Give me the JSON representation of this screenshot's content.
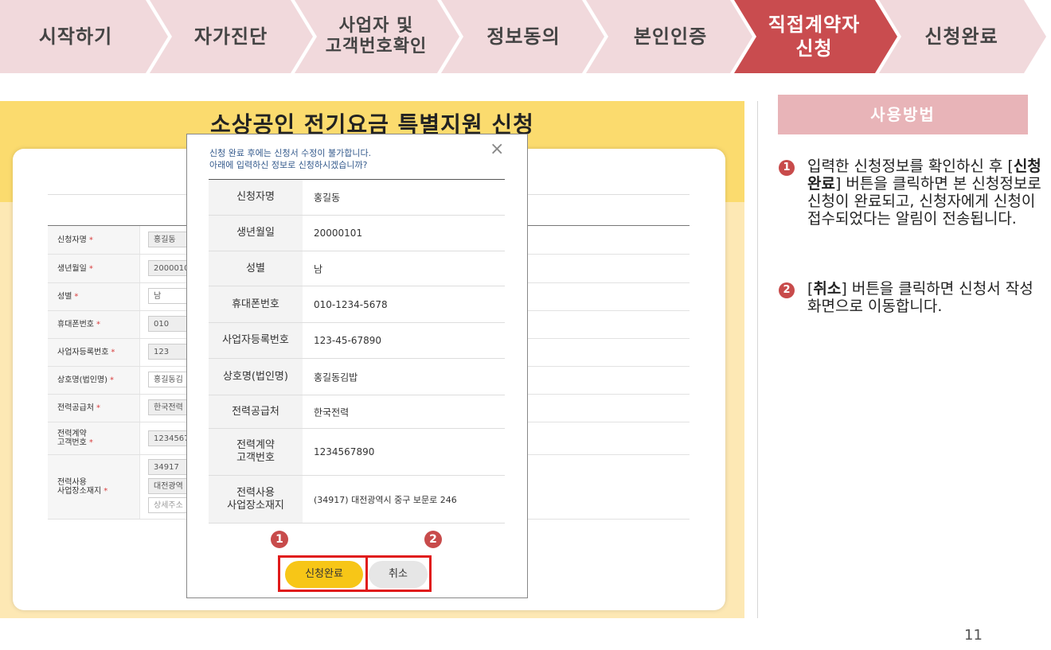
{
  "steps": [
    {
      "label": "시작하기",
      "active": false
    },
    {
      "label": "자가진단",
      "active": false
    },
    {
      "label": "사업자 및\n고객번호확인",
      "active": false
    },
    {
      "label": "정보동의",
      "active": false
    },
    {
      "label": "본인인증",
      "active": false
    },
    {
      "label": "직접계약자\n신청",
      "active": true
    },
    {
      "label": "신청완료",
      "active": false
    }
  ],
  "colors": {
    "step_inactive": "#f1d9dc",
    "step_active": "#c94c4f",
    "howto_bg": "#e8b4b8",
    "accent_red": "#c84b4b",
    "confirm_yellow": "#f7c617"
  },
  "page_title": "소상공인 전기요금 특별지원 신청",
  "form": {
    "rows": [
      {
        "label": "신청자명",
        "value": "홍길동"
      },
      {
        "label": "생년월일",
        "value": "2000010"
      },
      {
        "label": "성별",
        "value": "남"
      },
      {
        "label": "휴대폰번호",
        "value": "010"
      },
      {
        "label": "사업자등록번호",
        "value": "123"
      },
      {
        "label": "상호명(법인명)",
        "value": "홍길동김"
      },
      {
        "label": "전력공급처",
        "value": "한국전력"
      },
      {
        "label": "전력계약\n고객번호",
        "value": "1234567"
      },
      {
        "label": "전력사용\n사업장소재지",
        "postcode": "34917",
        "address": "대전광역",
        "detail_placeholder": "상세주소"
      }
    ],
    "required_mark": "*"
  },
  "modal": {
    "message_line1": "신청 완료 후에는 신청서 수정이 불가합니다.",
    "message_line2": "아래에 입력하신 정보로 신청하시겠습니까?",
    "close_icon": "×",
    "rows": [
      {
        "label": "신청자명",
        "value": "홍길동"
      },
      {
        "label": "생년월일",
        "value": "20000101"
      },
      {
        "label": "성별",
        "value": "남"
      },
      {
        "label": "휴대폰번호",
        "value": "010-1234-5678"
      },
      {
        "label": "사업자등록번호",
        "value": "123-45-67890"
      },
      {
        "label": "상호명(법인명)",
        "value": "홍길동김밥"
      },
      {
        "label": "전력공급처",
        "value": "한국전력"
      },
      {
        "label": "전력계약\n고객번호",
        "value": "1234567890"
      },
      {
        "label": "전력사용\n사업장소재지",
        "value": "(34917) 대전광역시 중구 보문로 246"
      }
    ],
    "confirm_label": "신청완료",
    "cancel_label": "취소",
    "badge1": "1",
    "badge2": "2"
  },
  "howto": {
    "title": "사용방법",
    "notes": [
      {
        "num": "1",
        "pre": "입력한 신청정보를 확인하신 후 [",
        "strong": "신청완료",
        "post": "] 버튼을 클릭하면 본 신청정보로 신청이 완료되고, 신청자에게 신청이 접수되었다는 알림이 전송됩니다."
      },
      {
        "num": "2",
        "pre": "[",
        "strong": "취소",
        "post": "] 버튼을 클릭하면 신청서 작성 화면으로 이동합니다."
      }
    ]
  },
  "page_number": "11"
}
